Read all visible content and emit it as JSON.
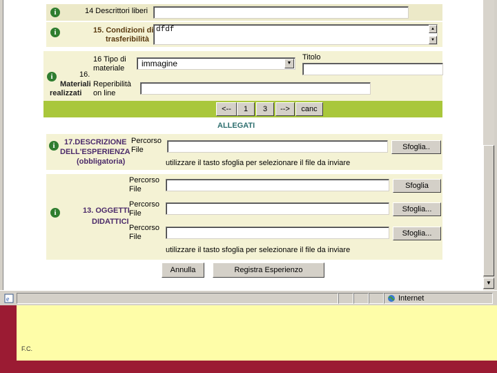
{
  "fields": {
    "descrittori_label": "14 Descrittori liberi",
    "descrittori_value": "",
    "condizioni_label_1": "15. Condizioni di",
    "condizioni_label_2": "trasferibilità",
    "condizioni_value": "dfdf",
    "materiali_label_1": "16.",
    "materiali_label_2": "Materiali",
    "materiali_label_3": "realizzati",
    "tipo_label_1": "16 Tipo di",
    "tipo_label_2": "materiale",
    "tipo_selected": "immagine",
    "titolo_label": "Titolo",
    "titolo_value": "",
    "reperibilita_label_1": "Reperibilità",
    "reperibilita_label_2": "on line",
    "reperibilita_value": ""
  },
  "pager": {
    "prev": "<--",
    "page1": "1",
    "page3": "3",
    "next": "-->",
    "canc": "canc"
  },
  "allegati": {
    "title": "ALLEGATI",
    "descr_label_1": "17.DESCRIZIONE",
    "descr_label_2": "DELL'ESPERIENZA",
    "descr_label_3": "(obbligatoria)",
    "path_label_1": "Percorso",
    "path_label_2": "File",
    "browse_label": "Sfoglia..",
    "browse_label_2": "Sfoglia",
    "browse_label_3": "Sfoglia...",
    "hint": "utilizzare il tasto sfoglia per selezionare il file da inviare",
    "oggetti_label_1": "13. OGGETTI",
    "oggetti_label_2": "DIDATTICI"
  },
  "actions": {
    "annulla": "Annulla",
    "registra": "Registra Esperienzo"
  },
  "statusbar": {
    "zone": "Internet"
  },
  "slide": {
    "footer": "F.C."
  }
}
